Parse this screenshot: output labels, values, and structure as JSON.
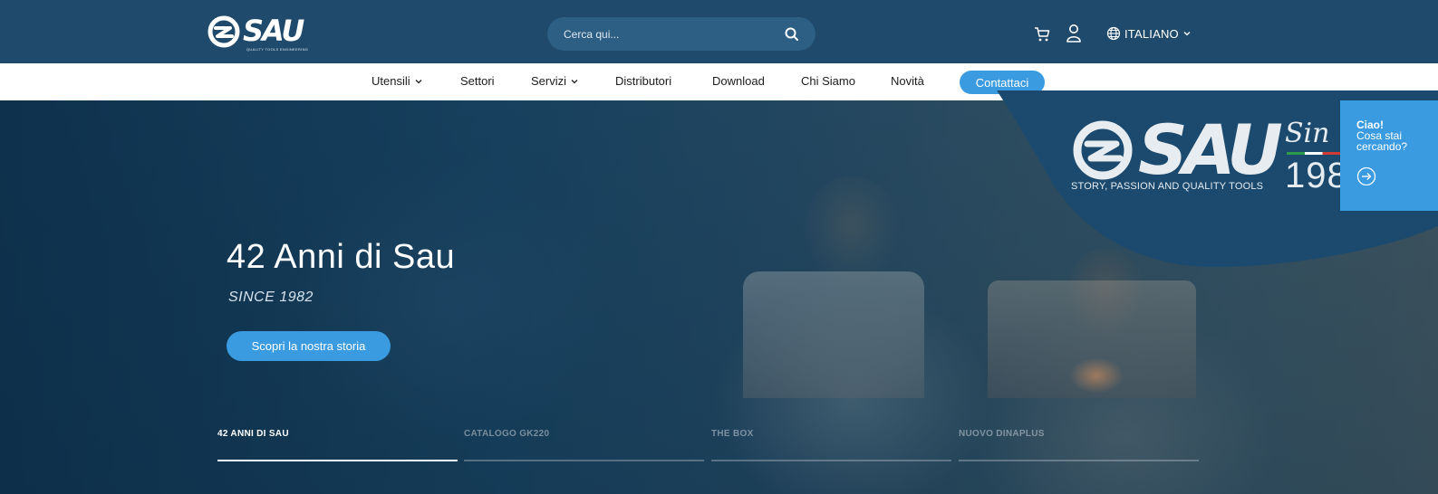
{
  "header": {
    "logo_text": "SAU",
    "logo_tagline": "QUALITY TOOLS ENGINEERING",
    "search_placeholder": "Cerca qui...",
    "language": "ITALIANO"
  },
  "nav": {
    "items": [
      {
        "label": "Utensili",
        "has_dropdown": true
      },
      {
        "label": "Settori",
        "has_dropdown": false
      },
      {
        "label": "Servizi",
        "has_dropdown": true
      },
      {
        "label": "Distributori",
        "has_dropdown": false
      },
      {
        "label": "Download",
        "has_dropdown": false
      },
      {
        "label": "Chi Siamo",
        "has_dropdown": false
      },
      {
        "label": "Novità",
        "has_dropdown": false
      }
    ],
    "contact_label": "Contattaci"
  },
  "hero": {
    "title": "42 Anni di Sau",
    "subtitle": "SINCE 1982",
    "cta_label": "Scopri la nostra storia",
    "slides": [
      {
        "label": "42 ANNI DI SAU",
        "active": true
      },
      {
        "label": "CATALOGO GK220",
        "active": false
      },
      {
        "label": "THE BOX",
        "active": false
      },
      {
        "label": "NUOVO DINAPLUS",
        "active": false
      }
    ]
  },
  "badge": {
    "logo_text": "SAU",
    "tagline": "STORY, PASSION AND QUALITY TOOLS",
    "since_script": "Sin",
    "year": "198"
  },
  "help_widget": {
    "title": "Ciao!",
    "text": "Cosa stai cercando?"
  },
  "colors": {
    "header_bg": "#1f4a6b",
    "accent": "#3a9be0",
    "badge_bg": "#1c4a6e"
  },
  "icons": {
    "search": "search-icon",
    "cart": "cart-icon",
    "user": "user-icon",
    "globe": "globe-icon",
    "chevron": "chevron-down-icon",
    "arrow": "arrow-right-circle-icon"
  }
}
